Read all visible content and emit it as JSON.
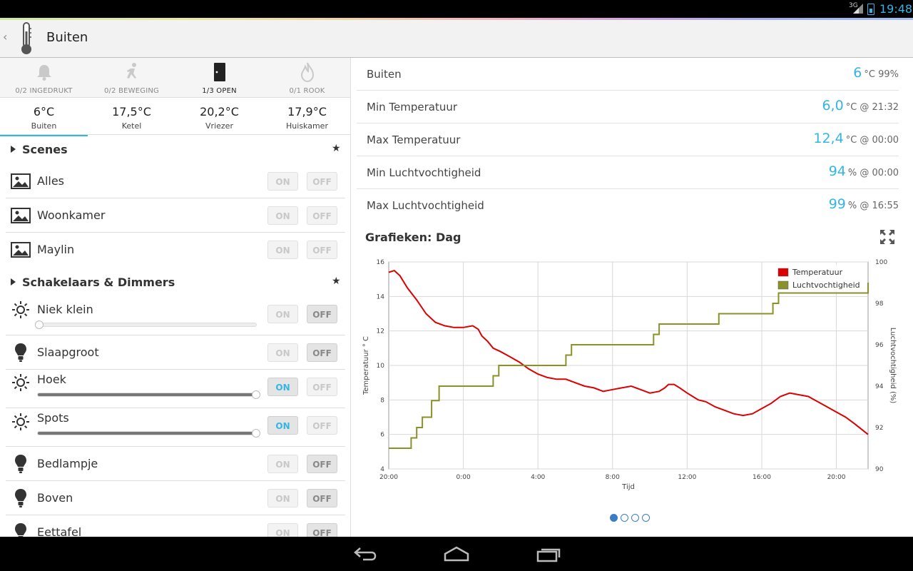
{
  "status_bar": {
    "network": "3G",
    "time": "19:48"
  },
  "action_bar": {
    "title": "Buiten",
    "icon": "thermometer-icon"
  },
  "sensors": [
    {
      "label": "0/2 INGEDRUKT",
      "icon": "bell-icon",
      "active": false
    },
    {
      "label": "0/2 BEWEGING",
      "icon": "running-person-icon",
      "active": false
    },
    {
      "label": "1/3 OPEN",
      "icon": "door-icon",
      "active": true
    },
    {
      "label": "0/1 ROOK",
      "icon": "flame-icon",
      "active": false
    }
  ],
  "temperatures": [
    {
      "value": "6°C",
      "name": "Buiten",
      "selected": true
    },
    {
      "value": "17,5°C",
      "name": "Ketel",
      "selected": false
    },
    {
      "value": "20,2°C",
      "name": "Vriezer",
      "selected": false
    },
    {
      "value": "17,9°C",
      "name": "Huiskamer",
      "selected": false
    }
  ],
  "scenes": {
    "title": "Scenes",
    "items": [
      {
        "label": "Alles",
        "icon": "image-icon",
        "on": "ON",
        "off": "OFF"
      },
      {
        "label": "Woonkamer",
        "icon": "image-icon",
        "on": "ON",
        "off": "OFF"
      },
      {
        "label": "Maylin",
        "icon": "image-icon",
        "on": "ON",
        "off": "OFF"
      }
    ]
  },
  "switches": {
    "title": "Schakelaars & Dimmers",
    "items": [
      {
        "label": "Niek klein",
        "icon": "sun-icon",
        "state": "off",
        "dimmer": 0.0
      },
      {
        "label": "Slaapgroot",
        "icon": "bulb-icon",
        "state": "off",
        "dimmer": null
      },
      {
        "label": "Hoek",
        "icon": "sun-icon",
        "state": "on",
        "dimmer": 1.0
      },
      {
        "label": "Spots",
        "icon": "sun-icon",
        "state": "on",
        "dimmer": 1.0
      },
      {
        "label": "Bedlampje",
        "icon": "bulb-icon",
        "state": "off",
        "dimmer": null
      },
      {
        "label": "Boven",
        "icon": "bulb-icon",
        "state": "off",
        "dimmer": null
      },
      {
        "label": "Eettafel",
        "icon": "bulb-icon",
        "state": "off",
        "dimmer": null
      }
    ],
    "on_label": "ON",
    "off_label": "OFF"
  },
  "stats": [
    {
      "label": "Buiten",
      "value": "6",
      "unit": "°C 99%"
    },
    {
      "label": "Min Temperatuur",
      "value": "6,0",
      "unit": "°C @ 21:32"
    },
    {
      "label": "Max Temperatuur",
      "value": "12,4",
      "unit": "°C @ 00:00"
    },
    {
      "label": "Min Luchtvochtigheid",
      "value": "94",
      "unit": "% @ 00:00"
    },
    {
      "label": "Max Luchtvochtigheid",
      "value": "99",
      "unit": "% @ 16:55"
    }
  ],
  "graph_title": "Grafieken: Dag",
  "pager": {
    "count": 4,
    "active": 0
  },
  "colors": {
    "accent": "#33b5e5",
    "temperature": "#dd0000",
    "humidity": "#8b9129"
  },
  "chart_data": {
    "type": "line",
    "xlabel": "Tijd",
    "ylabel": "Temperatuur ° C",
    "y2label": "Luchtvochtigheid (%)",
    "x_ticks": [
      "20:00",
      "0:00",
      "4:00",
      "8:00",
      "12:00",
      "16:00",
      "20:00"
    ],
    "y_ticks": [
      4,
      6,
      8,
      10,
      12,
      14,
      16
    ],
    "y2_ticks": [
      90,
      92,
      94,
      96,
      98,
      100
    ],
    "ylim": [
      4,
      16
    ],
    "y2lim": [
      90,
      100
    ],
    "xlim_hours": [
      0,
      25.7
    ],
    "legend": "top-right",
    "series": [
      {
        "name": "Temperatuur",
        "axis": "left",
        "x": [
          0,
          0.3,
          0.6,
          1,
          1.5,
          2,
          2.5,
          3,
          3.5,
          4,
          4.5,
          4.8,
          5,
          5.3,
          5.6,
          6,
          6.5,
          7,
          7.5,
          8,
          8.5,
          9,
          9.5,
          10,
          10.5,
          11,
          11.5,
          12,
          12.5,
          13,
          13.5,
          14,
          14.5,
          14.8,
          15,
          15.3,
          15.6,
          16,
          16.3,
          16.6,
          17,
          17.5,
          18,
          18.5,
          19,
          19.5,
          20,
          20.5,
          21,
          21.5,
          22,
          22.5,
          23,
          23.5,
          24,
          24.5,
          25,
          25.7
        ],
        "y": [
          15.4,
          15.5,
          15.2,
          14.5,
          13.8,
          13.0,
          12.5,
          12.3,
          12.2,
          12.2,
          12.3,
          12.1,
          11.7,
          11.4,
          11.0,
          10.8,
          10.5,
          10.2,
          9.8,
          9.5,
          9.3,
          9.2,
          9.2,
          9.0,
          8.8,
          8.7,
          8.5,
          8.6,
          8.7,
          8.8,
          8.6,
          8.4,
          8.5,
          8.7,
          8.9,
          8.9,
          8.7,
          8.4,
          8.2,
          8.0,
          7.9,
          7.6,
          7.4,
          7.2,
          7.1,
          7.2,
          7.5,
          7.8,
          8.2,
          8.4,
          8.3,
          8.2,
          7.9,
          7.6,
          7.3,
          7.0,
          6.6,
          6.0
        ]
      },
      {
        "name": "Luchtvochtigheid",
        "axis": "right",
        "x": [
          0,
          1.2,
          1.2,
          1.5,
          1.5,
          1.8,
          1.8,
          2.3,
          2.3,
          2.7,
          2.7,
          5.6,
          5.6,
          5.9,
          5.9,
          9.5,
          9.5,
          9.8,
          9.8,
          14.2,
          14.2,
          14.5,
          14.5,
          17.7,
          17.7,
          20.6,
          20.6,
          20.9,
          20.9,
          26.2,
          26.2,
          26.5,
          26.5
        ],
        "y": [
          91,
          91,
          91.5,
          91.5,
          92,
          92,
          92.5,
          92.5,
          93.3,
          93.3,
          94,
          94,
          94.5,
          94.5,
          95,
          95,
          95.5,
          95.5,
          96,
          96,
          96.5,
          96.5,
          97,
          97,
          97.5,
          97.5,
          98,
          98,
          98.5,
          98.5,
          99,
          99,
          99
        ]
      }
    ]
  }
}
